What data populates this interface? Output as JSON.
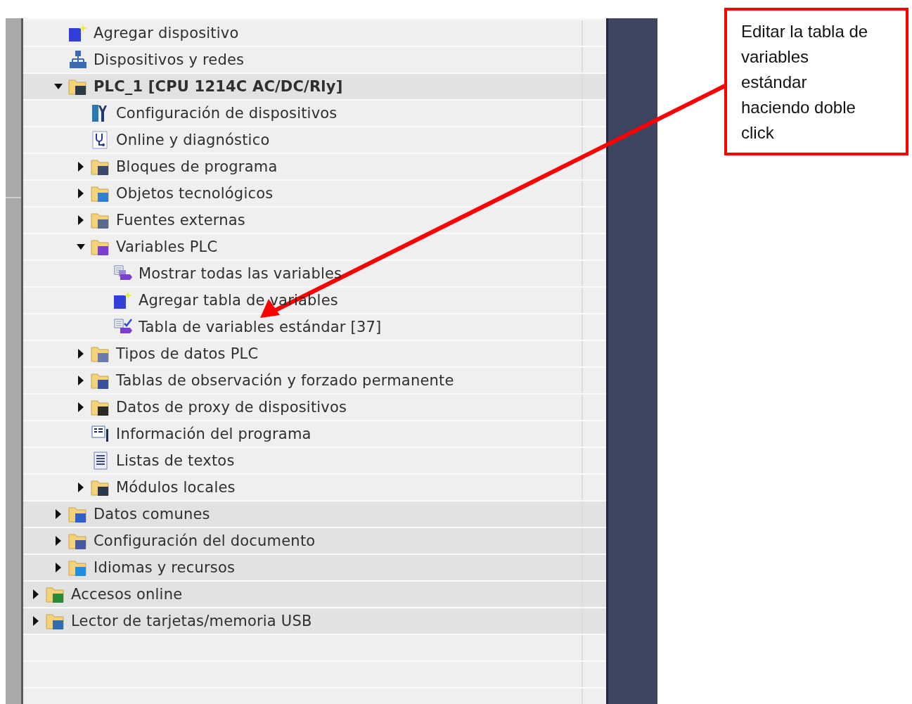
{
  "tree": {
    "project_children": [
      {
        "label": "Agregar dispositivo",
        "kind": "add",
        "highlighted": false
      },
      {
        "label": "Dispositivos y redes",
        "kind": "network",
        "highlighted": false
      },
      {
        "label": "PLC_1 [CPU 1214C AC/DC/Rly]",
        "kind": "folder-plc",
        "highlighted": true,
        "expanded": true,
        "children": [
          {
            "label": "Configuración de dispositivos",
            "kind": "device-config",
            "highlighted": false
          },
          {
            "label": "Online y diagnóstico",
            "kind": "diagnostics",
            "highlighted": false
          },
          {
            "label": "Bloques de programa",
            "kind": "folder-blocks",
            "highlighted": false,
            "expanded": false
          },
          {
            "label": "Objetos tecnológicos",
            "kind": "folder-tech",
            "highlighted": false,
            "expanded": false
          },
          {
            "label": "Fuentes externas",
            "kind": "folder-sources",
            "highlighted": false,
            "expanded": false
          },
          {
            "label": "Variables PLC",
            "kind": "folder-tags",
            "highlighted": false,
            "expanded": true,
            "children": [
              {
                "label": "Mostrar todas las variables",
                "kind": "tags-all",
                "highlighted": false
              },
              {
                "label": "Agregar tabla de variables",
                "kind": "add",
                "highlighted": false
              },
              {
                "label": "Tabla de variables estándar [37]",
                "kind": "tag-table",
                "highlighted": false
              }
            ]
          },
          {
            "label": "Tipos de datos PLC",
            "kind": "folder-types",
            "highlighted": false,
            "expanded": false
          },
          {
            "label": "Tablas de observación y forzado permanente",
            "kind": "folder-watch",
            "highlighted": false,
            "expanded": false
          },
          {
            "label": "Datos de proxy de dispositivos",
            "kind": "folder-proxy",
            "highlighted": false,
            "expanded": false
          },
          {
            "label": "Información del programa",
            "kind": "program-info",
            "highlighted": false
          },
          {
            "label": "Listas de textos",
            "kind": "text-list",
            "highlighted": false
          },
          {
            "label": "Módulos locales",
            "kind": "folder-plc",
            "highlighted": false,
            "expanded": false
          }
        ]
      },
      {
        "label": "Datos comunes",
        "kind": "folder-common",
        "highlighted": true,
        "expanded": false
      },
      {
        "label": "Configuración del documento",
        "kind": "folder-docs",
        "highlighted": true,
        "expanded": false
      },
      {
        "label": "Idiomas y recursos",
        "kind": "folder-languages",
        "highlighted": true,
        "expanded": false
      }
    ],
    "root_items": [
      {
        "label": "Accesos online",
        "kind": "folder-online",
        "highlighted": true,
        "expanded": false
      },
      {
        "label": "Lector de tarjetas/memoria USB",
        "kind": "folder-card",
        "highlighted": true,
        "expanded": false
      }
    ]
  },
  "annotation": {
    "lines": [
      "Editar la tabla de",
      "variables",
      "estándar",
      "haciendo doble",
      "click"
    ]
  }
}
